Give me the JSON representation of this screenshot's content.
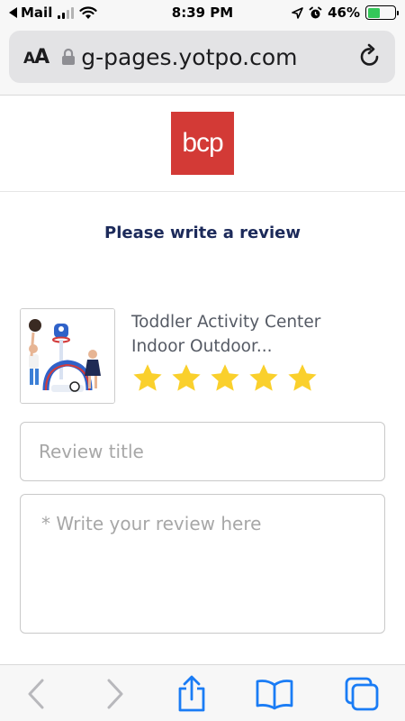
{
  "status_bar": {
    "back_app": "Mail",
    "time": "8:39 PM",
    "battery": "46%",
    "battery_level": 0.46
  },
  "browser": {
    "aa_label_small": "A",
    "aa_label_large": "A",
    "url": "g-pages.yotpo.com"
  },
  "brand": {
    "logo_text": "bcp",
    "logo_color": "#d33a36"
  },
  "page": {
    "heading": "Please write a review"
  },
  "product": {
    "title_line1": "Toddler Activity Center",
    "title_line2": "Indoor Outdoor...",
    "rating": 5,
    "rating_max": 5,
    "star_color": "#fad02c"
  },
  "form": {
    "title_placeholder": "Review title",
    "title_value": "",
    "body_placeholder": "* Write your review here",
    "body_value": ""
  },
  "toolbar": {
    "icons": [
      "back-icon",
      "forward-icon",
      "share-icon",
      "bookmarks-icon",
      "tabs-icon"
    ],
    "accent": "#1a7cf5"
  }
}
